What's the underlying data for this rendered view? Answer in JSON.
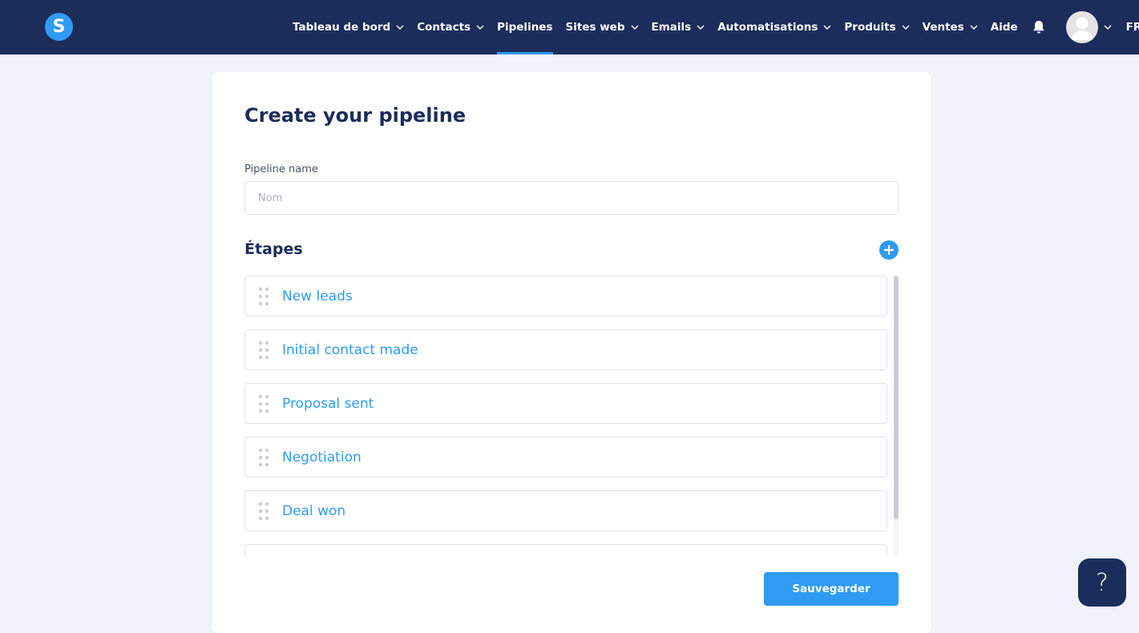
{
  "app": {
    "logo_letter": "S",
    "brand_color": "#2f9bf2",
    "nav_color": "#1c2c5b"
  },
  "nav": {
    "items": [
      {
        "label": "Tableau de bord",
        "has_dropdown": true,
        "active": false
      },
      {
        "label": "Contacts",
        "has_dropdown": true,
        "active": false
      },
      {
        "label": "Pipelines",
        "has_dropdown": false,
        "active": true
      },
      {
        "label": "Sites web",
        "has_dropdown": true,
        "active": false
      },
      {
        "label": "Emails",
        "has_dropdown": true,
        "active": false
      },
      {
        "label": "Automatisations",
        "has_dropdown": true,
        "active": false
      },
      {
        "label": "Produits",
        "has_dropdown": true,
        "active": false
      },
      {
        "label": "Ventes",
        "has_dropdown": true,
        "active": false
      },
      {
        "label": "Aide",
        "has_dropdown": false,
        "active": false
      }
    ],
    "notification_icon": "bell-icon",
    "avatar_icon": "user-avatar-icon",
    "language": "FR"
  },
  "page": {
    "title": "Create your pipeline",
    "pipeline_name_label": "Pipeline name",
    "pipeline_name_value": "",
    "pipeline_name_placeholder": "Nom",
    "stages_title": "Étapes",
    "add_stage_icon": "plus-circle-icon",
    "stages": [
      {
        "label": "New leads"
      },
      {
        "label": "Initial contact made"
      },
      {
        "label": "Proposal sent"
      },
      {
        "label": "Negotiation"
      },
      {
        "label": "Deal won"
      },
      {
        "label": ""
      }
    ],
    "save_label": "Sauvegarder"
  },
  "help": {
    "label": "?"
  }
}
